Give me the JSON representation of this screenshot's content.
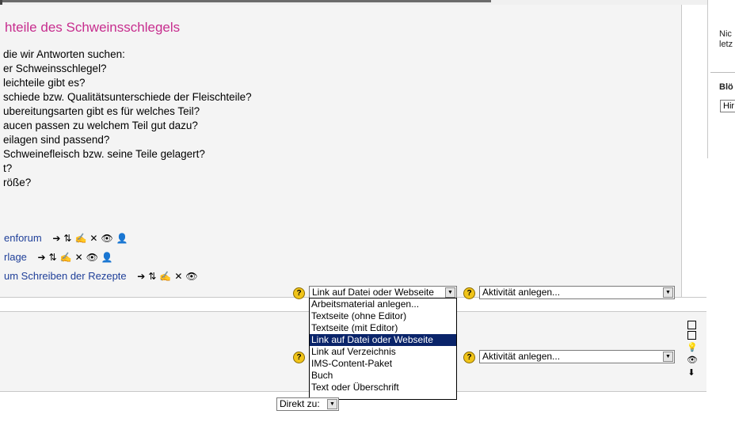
{
  "section": {
    "heading": "hteile des Schweinsschlegels",
    "questions": [
      "die wir Antworten suchen:",
      "er Schweinsschlegel?",
      "leichteile gibt es?",
      "schiede bzw. Qualitätsunterschiede der Fleischteile?",
      "ubereitungsarten gibt es für welches Teil?",
      "aucen passen zu welchem Teil gut dazu?",
      "eilagen sind passend?",
      "Schweinefleisch bzw. seine Teile gelagert?",
      "t?",
      "röße?"
    ],
    "activities": [
      {
        "label": "enforum"
      },
      {
        "label": "rlage"
      },
      {
        "label": "um Schreiben der Rezepte"
      }
    ],
    "tool_icons": {
      "move": "➔",
      "indent": "⇅",
      "edit": "✍",
      "delete": "✕",
      "hide": "👁",
      "roles": "👤"
    }
  },
  "help_icon": "?",
  "add_resource": {
    "selected": "Link auf Datei oder Webseite",
    "options": [
      "Arbeitsmaterial anlegen...",
      "Textseite (ohne Editor)",
      "Textseite (mit Editor)",
      "Link auf Datei oder Webseite",
      "Link auf Verzeichnis",
      "IMS-Content-Paket",
      "Buch",
      "Text oder Überschrift"
    ],
    "selected_index": 3
  },
  "add_activity": {
    "label1": "Aktivität anlegen...",
    "label2": "Aktivität anlegen..."
  },
  "sidebar": {
    "text_line1": "Nic",
    "text_line2": "letz",
    "block_title": "Blö",
    "block_select": "Hir"
  },
  "jump": {
    "label": "Direkt zu:"
  },
  "section_tools": {
    "icons": [
      "square-icon",
      "square-icon",
      "lightbulb-icon",
      "eye-icon",
      "arrow-down-icon"
    ]
  }
}
